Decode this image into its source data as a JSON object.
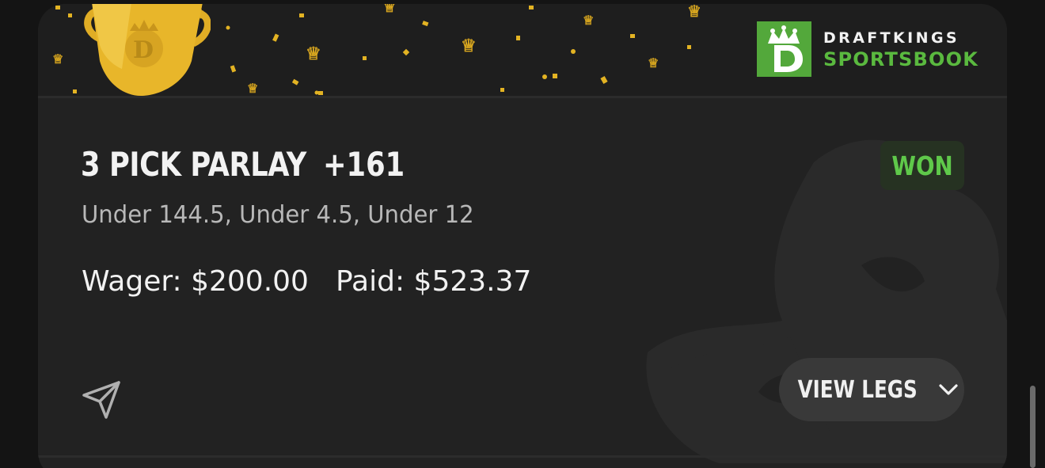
{
  "brand": {
    "line1": "DRAFTKINGS",
    "line2": "SPORTSBOOK",
    "logo_icon": "draftkings-crown-d-logo",
    "accent_color": "#53a83b"
  },
  "bet": {
    "title": "3 PICK PARLAY",
    "odds": "+161",
    "status": "WON",
    "legs_summary": "Under 144.5, Under 4.5, Under 12",
    "wager_text": "Wager: $200.00",
    "paid_text": "Paid: $523.37"
  },
  "actions": {
    "share_icon": "share-paper-plane-icon",
    "view_legs_label": "VIEW LEGS",
    "view_legs_icon": "chevron-down-icon"
  },
  "colors": {
    "background": "#141414",
    "card": "#222222",
    "won_text": "#5fc94a",
    "won_bg": "#263222",
    "confetti": "#e8b824"
  }
}
